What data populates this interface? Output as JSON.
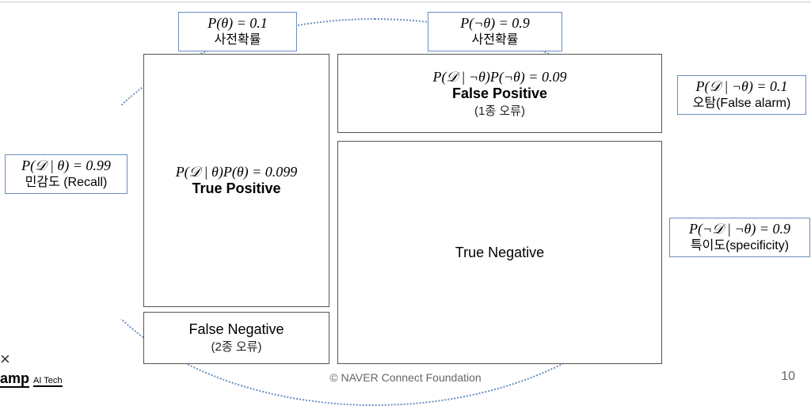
{
  "labels": {
    "prior_theta": {
      "formula": "P(θ) = 0.1",
      "kr": "사전확률"
    },
    "prior_nottheta": {
      "formula": "P(¬θ) = 0.9",
      "kr": "사전확률"
    },
    "sensitivity": {
      "formula": "P(𝒟 | θ) = 0.99",
      "kr": "민감도 (Recall)"
    },
    "false_alarm": {
      "formula": "P(𝒟 | ¬θ) = 0.1",
      "kr": "오탐(False alarm)"
    },
    "specificity": {
      "formula": "P(¬𝒟 | ¬θ) = 0.9",
      "kr": "특이도(specificity)"
    }
  },
  "cells": {
    "tp": {
      "formula": "P(𝒟 | θ)P(θ) = 0.099",
      "name": "True Positive",
      "sub": ""
    },
    "fp": {
      "formula": "P(𝒟 | ¬θ)P(¬θ) = 0.09",
      "name": "False Positive",
      "sub": "(1종 오류)"
    },
    "fn": {
      "formula": "",
      "name": "False Negative",
      "sub": "(2종 오류)"
    },
    "tn": {
      "formula": "",
      "name": "True Negative",
      "sub": ""
    }
  },
  "footer": {
    "brand_main": "amp",
    "brand_sub": "AI Tech",
    "copyright": "©  NAVER Connect Foundation",
    "page": "10"
  }
}
